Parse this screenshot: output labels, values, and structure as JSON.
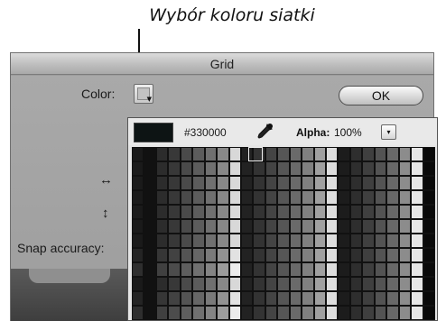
{
  "caption": "Wybór koloru siatki",
  "dialog": {
    "title": "Grid",
    "color_label": "Color:",
    "ok_label": "OK",
    "horizontal_label": "↔",
    "vertical_label": "↕",
    "snap_label": "Snap accuracy:"
  },
  "picker": {
    "hex": "#330000",
    "preview_color": "#0d1414",
    "alpha_label": "Alpha:",
    "alpha_value": "100%",
    "alpha_menu_glyph": "▾"
  },
  "swatch_columns": [
    "#1a1a1a",
    "#0d0d0d",
    "#2c2c2c",
    "#383838",
    "#4a4a4a",
    "#5c5c5c",
    "#707070",
    "#888888",
    "#d8d8d8",
    "#222222",
    "#333333",
    "#444444",
    "#565656",
    "#6a6a6a",
    "#808080",
    "#a0a0a0",
    "#dddddd",
    "#1c1c1c",
    "#2e2e2e",
    "#3f3f3f",
    "#535353",
    "#686868",
    "#8c8c8c",
    "#e6e6e6",
    "#090909"
  ],
  "swatch_rows": 12
}
